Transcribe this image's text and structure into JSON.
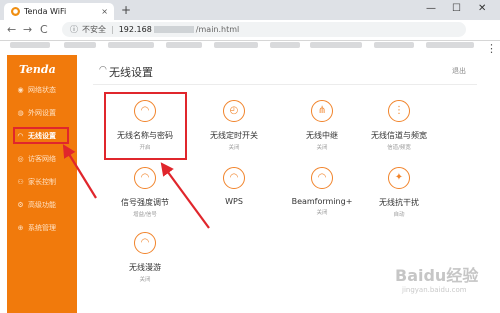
{
  "browser": {
    "tab_title": "Tenda WiFi",
    "tab_close": "×",
    "new_tab": "+",
    "window_min": "—",
    "window_max": "☐",
    "window_close": "✕",
    "back": "←",
    "forward": "→",
    "reload": "C",
    "security_label": "不安全",
    "url_host": "192.168",
    "url_path": "/main.html",
    "menu": "⋮"
  },
  "sidebar": {
    "logo": "Tenda",
    "items": [
      {
        "label": "网络状态",
        "icon": "◉"
      },
      {
        "label": "外网设置",
        "icon": "◍"
      },
      {
        "label": "无线设置",
        "icon": "◠",
        "active": true
      },
      {
        "label": "访客网络",
        "icon": "◎"
      },
      {
        "label": "家长控制",
        "icon": "⚇"
      },
      {
        "label": "高级功能",
        "icon": "⚙"
      },
      {
        "label": "系统管理",
        "icon": "⊕"
      }
    ]
  },
  "main": {
    "title_icon": "◠",
    "title": "无线设置",
    "logout": "退出",
    "tiles": [
      {
        "label": "无线名称与密码",
        "sub": "开启",
        "icon": "◠"
      },
      {
        "label": "无线定时开关",
        "sub": "关闭",
        "icon": "◴"
      },
      {
        "label": "无线中继",
        "sub": "关闭",
        "icon": "⋔"
      },
      {
        "label": "无线信道与频宽",
        "sub": "信道/频宽",
        "icon": "⋮"
      },
      {
        "label": "信号强度调节",
        "sub": "增益/信号",
        "icon": "◠"
      },
      {
        "label": "WPS",
        "sub": "",
        "icon": "◠"
      },
      {
        "label": "Beamforming+",
        "sub": "关闭",
        "icon": "◠"
      },
      {
        "label": "无线抗干扰",
        "sub": "自动",
        "icon": "✦"
      },
      {
        "label": "无线漫游",
        "sub": "关闭",
        "icon": "◠"
      }
    ]
  },
  "watermark": {
    "logo": "Baidu经验",
    "url": "jingyan.baidu.com"
  },
  "colors": {
    "sidebar": "#f17a0c",
    "accent": "#f1842b",
    "highlight": "#e0262c"
  }
}
